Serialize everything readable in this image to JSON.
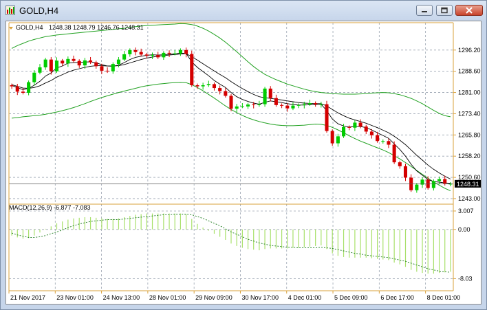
{
  "window": {
    "title": "GOLD,H4"
  },
  "price_header": {
    "symbol_tf": "GOLD,H4",
    "ohlc": "1248.38 1248.79 1246.76 1248.31"
  },
  "macd_header": {
    "text": "MACD(12,26,9) -6.877 -7.083"
  },
  "colors": {
    "up": "#00cc00",
    "down": "#d40000",
    "axis": "#d9a13b",
    "bands": "#1fa01f",
    "ma": "#000000",
    "macd_hist": "#a8e06a"
  },
  "chart_data": [
    {
      "type": "candlestick",
      "title": "GOLD,H4",
      "y_ticks": [
        "1296.20",
        "1288.60",
        "1281.00",
        "1273.40",
        "1265.80",
        "1258.20",
        "1250.60",
        "1243.00"
      ],
      "y_range": [
        1242.0,
        1306.0
      ],
      "x_labels": [
        "21 Nov 2017",
        "23 Nov 01:00",
        "24 Nov 13:00",
        "28 Nov 01:00",
        "29 Nov 09:00",
        "30 Nov 17:00",
        "4 Dec 01:00",
        "5 Dec 09:00",
        "6 Dec 17:00",
        "8 Dec 01:00"
      ],
      "current_price": "1248.31",
      "current_value": 1248.31,
      "close": [
        1283.2,
        1281.3,
        1280.9,
        1284.7,
        1288.1,
        1290.0,
        1292.8,
        1288.6,
        1292.4,
        1291.4,
        1293.0,
        1292.3,
        1290.7,
        1292.5,
        1291.8,
        1290.4,
        1288.8,
        1288.6,
        1291.2,
        1292.8,
        1294.7,
        1296.2,
        1295.5,
        1294.6,
        1294.2,
        1294.4,
        1293.6,
        1295.2,
        1294.9,
        1295.0,
        1296.2,
        1294.8,
        1283.6,
        1283.2,
        1283.6,
        1284.0,
        1282.6,
        1281.5,
        1279.8,
        1275.2,
        1276.0,
        1276.0,
        1276.7,
        1276.5,
        1276.8,
        1282.4,
        1279.0,
        1276.5,
        1276.3,
        1275.3,
        1276.3,
        1276.5,
        1276.8,
        1277.2,
        1276.8,
        1276.8,
        1267.2,
        1262.8,
        1265.3,
        1268.6,
        1268.4,
        1270.2,
        1268.8,
        1267.0,
        1265.7,
        1263.6,
        1263.6,
        1262.3,
        1256.0,
        1254.6,
        1250.5,
        1246.0,
        1248.0,
        1249.8,
        1246.8,
        1249.3,
        1250.0,
        1248.3,
        1248.3
      ],
      "bands_upper": [
        1296.8,
        1297.8,
        1298.6,
        1299.4,
        1300.0,
        1300.5,
        1301.0,
        1301.3,
        1301.6,
        1301.8,
        1302.0,
        1302.2,
        1302.4,
        1302.6,
        1302.8,
        1303.0,
        1303.2,
        1303.4,
        1303.6,
        1303.8,
        1304.0,
        1304.3,
        1304.6,
        1304.8,
        1305.0,
        1305.1,
        1305.2,
        1305.3,
        1305.4,
        1305.5,
        1305.7,
        1305.6,
        1305.3,
        1304.8,
        1304.0,
        1303.0,
        1301.8,
        1300.5,
        1299.0,
        1297.3,
        1295.6,
        1293.8,
        1292.0,
        1290.3,
        1288.8,
        1287.5,
        1286.5,
        1285.6,
        1284.8,
        1284.0,
        1283.4,
        1282.8,
        1282.2,
        1281.7,
        1281.3,
        1281.0,
        1280.8,
        1280.6,
        1280.5,
        1280.4,
        1280.4,
        1280.4,
        1280.5,
        1280.6,
        1280.8,
        1280.9,
        1281.0,
        1280.9,
        1280.6,
        1280.2,
        1279.6,
        1278.9,
        1278.0,
        1277.0,
        1275.8,
        1274.6,
        1273.5,
        1272.7,
        1272.3
      ],
      "bands_lower": [
        1271.8,
        1272.0,
        1272.3,
        1272.5,
        1272.7,
        1272.9,
        1273.2,
        1273.6,
        1274.0,
        1274.5,
        1275.0,
        1275.6,
        1276.3,
        1277.0,
        1277.8,
        1278.5,
        1279.2,
        1279.8,
        1280.4,
        1281.0,
        1281.5,
        1282.0,
        1282.5,
        1283.0,
        1283.4,
        1283.7,
        1284.0,
        1284.2,
        1284.4,
        1284.5,
        1284.6,
        1284.5,
        1283.8,
        1282.8,
        1281.6,
        1280.3,
        1279.0,
        1277.6,
        1276.2,
        1274.9,
        1273.8,
        1272.8,
        1271.9,
        1271.2,
        1270.6,
        1270.1,
        1269.7,
        1269.4,
        1269.2,
        1269.1,
        1269.1,
        1269.2,
        1269.3,
        1269.5,
        1269.7,
        1269.6,
        1269.2,
        1268.5,
        1267.6,
        1266.6,
        1265.5,
        1264.5,
        1263.6,
        1262.8,
        1262.0,
        1261.2,
        1260.4,
        1259.5,
        1258.4,
        1257.2,
        1255.9,
        1254.5,
        1253.1,
        1251.7,
        1250.3,
        1249.0,
        1247.8,
        1246.7,
        1245.8
      ],
      "ma_fast": [
        1283.5,
        1282.8,
        1282.0,
        1282.5,
        1283.6,
        1285.0,
        1286.9,
        1288.0,
        1289.8,
        1290.5,
        1291.5,
        1291.7,
        1291.8,
        1291.9,
        1292.0,
        1291.6,
        1291.0,
        1290.5,
        1290.4,
        1290.8,
        1291.7,
        1292.8,
        1293.6,
        1294.0,
        1294.3,
        1294.5,
        1294.4,
        1294.5,
        1294.7,
        1294.8,
        1295.1,
        1295.0,
        1292.0,
        1290.0,
        1288.5,
        1287.0,
        1285.3,
        1284.0,
        1282.8,
        1281.0,
        1279.5,
        1278.5,
        1277.8,
        1277.2,
        1276.8,
        1277.5,
        1278.0,
        1277.7,
        1277.4,
        1277.0,
        1276.7,
        1276.5,
        1276.5,
        1276.6,
        1276.7,
        1276.8,
        1274.5,
        1271.5,
        1269.8,
        1269.0,
        1268.6,
        1268.8,
        1268.8,
        1268.4,
        1267.6,
        1266.6,
        1265.6,
        1264.6,
        1262.6,
        1260.6,
        1258.2,
        1255.3,
        1252.9,
        1251.4,
        1249.8,
        1249.1,
        1248.9,
        1248.6,
        1248.5
      ],
      "ma_slow": [
        1283.8,
        1283.2,
        1282.6,
        1282.5,
        1282.8,
        1283.4,
        1284.4,
        1285.3,
        1286.5,
        1287.4,
        1288.3,
        1289.0,
        1289.5,
        1290.0,
        1290.4,
        1290.6,
        1290.6,
        1290.5,
        1290.5,
        1290.6,
        1291.0,
        1291.6,
        1292.2,
        1292.8,
        1293.3,
        1293.7,
        1294.0,
        1294.2,
        1294.4,
        1294.6,
        1294.8,
        1294.9,
        1293.8,
        1292.6,
        1291.3,
        1290.0,
        1288.7,
        1287.5,
        1286.3,
        1284.9,
        1283.6,
        1282.4,
        1281.3,
        1280.3,
        1279.5,
        1279.1,
        1278.9,
        1278.6,
        1278.3,
        1278.0,
        1277.7,
        1277.4,
        1277.2,
        1277.1,
        1277.0,
        1277.0,
        1276.2,
        1274.9,
        1273.7,
        1272.7,
        1271.8,
        1271.2,
        1270.6,
        1270.0,
        1269.2,
        1268.4,
        1267.5,
        1266.6,
        1265.3,
        1263.9,
        1262.3,
        1260.4,
        1258.5,
        1256.8,
        1255.0,
        1253.5,
        1252.2,
        1251.0,
        1250.0
      ]
    },
    {
      "type": "bar",
      "title": "MACD(12,26,9) -6.877 -7.083",
      "y_ticks": [
        "3.007",
        "0.00",
        "-8.03"
      ],
      "y_range": [
        -10.0,
        3.9
      ],
      "macd": [
        -1.0,
        -1.3,
        -1.5,
        -1.4,
        -1.0,
        -0.5,
        0.1,
        0.5,
        1.0,
        1.3,
        1.6,
        1.8,
        1.9,
        2.0,
        2.0,
        1.9,
        1.8,
        1.7,
        1.7,
        1.8,
        2.0,
        2.2,
        2.4,
        2.5,
        2.6,
        2.6,
        2.6,
        2.6,
        2.6,
        2.6,
        2.6,
        2.5,
        1.7,
        0.9,
        0.3,
        -0.2,
        -0.7,
        -1.2,
        -1.7,
        -2.3,
        -2.7,
        -3.0,
        -3.2,
        -3.3,
        -3.4,
        -3.2,
        -3.1,
        -3.1,
        -3.1,
        -3.1,
        -3.0,
        -3.0,
        -2.9,
        -2.8,
        -2.7,
        -2.6,
        -3.2,
        -3.9,
        -4.3,
        -4.5,
        -4.6,
        -4.6,
        -4.6,
        -4.6,
        -4.7,
        -4.8,
        -4.9,
        -5.0,
        -5.4,
        -5.7,
        -6.1,
        -6.6,
        -6.9,
        -7.1,
        -7.2,
        -7.2,
        -7.1,
        -7.0,
        -6.9
      ],
      "signal": [
        -0.6,
        -0.9,
        -1.1,
        -1.3,
        -1.3,
        -1.2,
        -1.0,
        -0.7,
        -0.4,
        -0.1,
        0.3,
        0.6,
        0.9,
        1.1,
        1.3,
        1.4,
        1.5,
        1.6,
        1.6,
        1.6,
        1.7,
        1.8,
        1.9,
        2.0,
        2.1,
        2.2,
        2.3,
        2.4,
        2.4,
        2.5,
        2.5,
        2.5,
        2.4,
        2.1,
        1.8,
        1.4,
        1.0,
        0.6,
        0.1,
        -0.4,
        -0.8,
        -1.2,
        -1.6,
        -1.9,
        -2.2,
        -2.4,
        -2.6,
        -2.7,
        -2.8,
        -2.9,
        -2.9,
        -3.0,
        -3.0,
        -3.0,
        -3.0,
        -2.9,
        -3.0,
        -3.1,
        -3.3,
        -3.5,
        -3.7,
        -3.9,
        -4.0,
        -4.2,
        -4.3,
        -4.4,
        -4.5,
        -4.6,
        -4.8,
        -5.0,
        -5.2,
        -5.5,
        -5.8,
        -6.1,
        -6.4,
        -6.6,
        -6.8,
        -6.9,
        -7.0
      ]
    }
  ]
}
